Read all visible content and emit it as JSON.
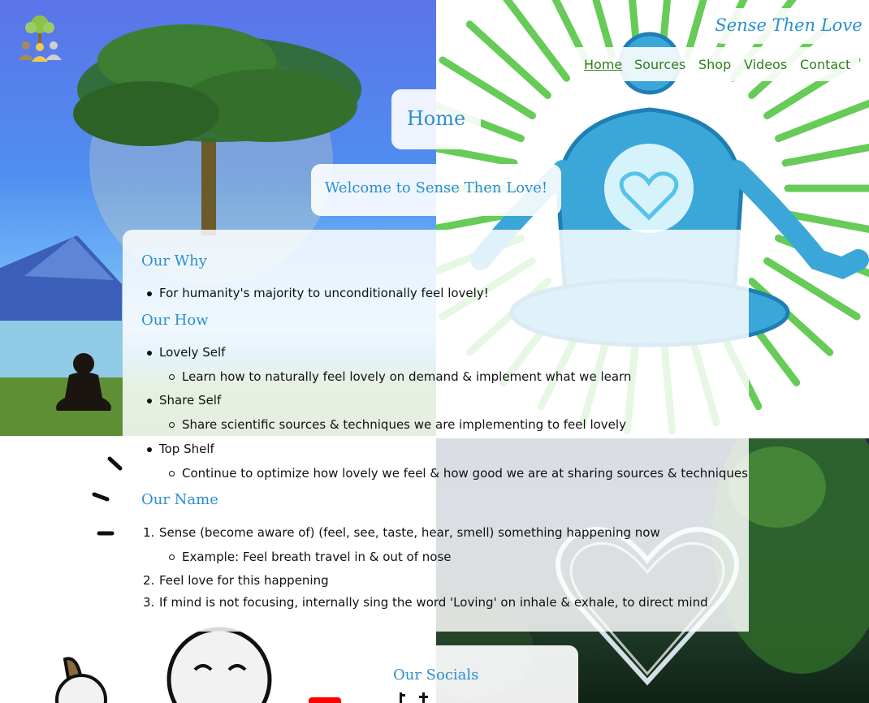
{
  "header": {
    "brand": "Sense Then Love",
    "nav": [
      "Home",
      "Sources",
      "Shop",
      "Videos",
      "Contact"
    ],
    "active_nav": "Home"
  },
  "page": {
    "title": "Home",
    "welcome": "Welcome to Sense Then Love!"
  },
  "why": {
    "heading": "Our Why",
    "items": [
      "For humanity's majority to unconditionally feel lovely!"
    ]
  },
  "how": {
    "heading": "Our How",
    "items": [
      {
        "label": "Lovely Self",
        "sub": "Learn how to naturally feel lovely on demand & implement what we learn"
      },
      {
        "label": "Share Self",
        "sub": "Share scientific sources & techniques we are implementing to feel lovely"
      },
      {
        "label": "Top Shelf",
        "sub": "Continue to optimize how lovely we feel & how good we are at sharing sources & techniques"
      }
    ]
  },
  "name": {
    "heading": "Our Name",
    "items": [
      {
        "num": "1.",
        "text": "Sense (become aware of) (feel, see, taste, hear, smell) something happening now",
        "sub": "Example: Feel breath travel in & out of nose"
      },
      {
        "num": "2.",
        "text": "Feel love for this happening"
      },
      {
        "num": "3.",
        "text": "If mind is not focusing, internally sing the word 'Loving' on inhale & exhale, to direct mind"
      }
    ]
  },
  "socials": {
    "heading": "Our Socials",
    "icons": [
      "youtube-icon",
      "tiktok-icon",
      "threads-icon",
      "twitter-icon",
      "facebook-icon"
    ]
  },
  "colors": {
    "accent_blue": "#2a8fd1",
    "nav_green": "#2d7d1a",
    "figure_blue": "#3aa7d8",
    "ray_green": "#4cc23a"
  }
}
